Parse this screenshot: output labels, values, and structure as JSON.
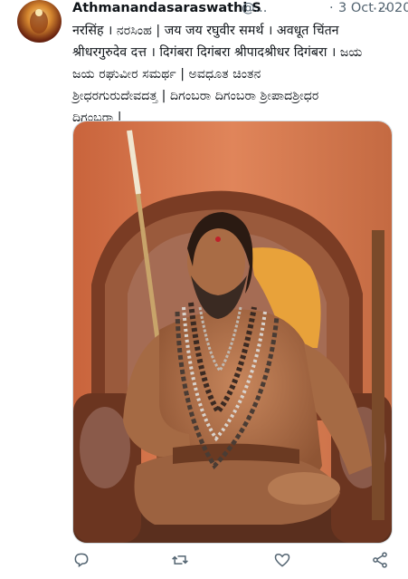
{
  "tweet": {
    "display_name": "Athmanandasaraswathi S",
    "handle": "@...",
    "separator": "·",
    "date": "3 Oct 2020",
    "more": "···",
    "text": "नरसिंह । ನರಸಿಂಹ | जय जय रघुवीर समर्थ । अवधूत चिंतन\nश्रीधरगुरुदेव दत्त । दिगंबरा दिगंबरा श्रीपादश्रीधर दिगंबरा । ಜಯ\nಜಯ ರಘುವೀರ ಸಮರ್ಥ | ಅವಧೂತ ಚಿಂತನ\nಶ್ರೀಧರಗುರುದೇವದತ್ತ | ದಿಗಂಬರಾ ದಿಗಂಬರಾ ಶ್ರೀಪಾದಶ್ರೀಧರ\nದಿಗಂಬರಾ |"
  },
  "icons": {
    "avatar": "avatar-image",
    "more": "more-icon",
    "reply": "reply-icon",
    "retweet": "retweet-icon",
    "like": "like-icon",
    "share": "share-icon"
  },
  "colors": {
    "text": "#0f1419",
    "secondary": "#536471",
    "wall": "#d9794a",
    "cloth": "#e8a23a"
  }
}
